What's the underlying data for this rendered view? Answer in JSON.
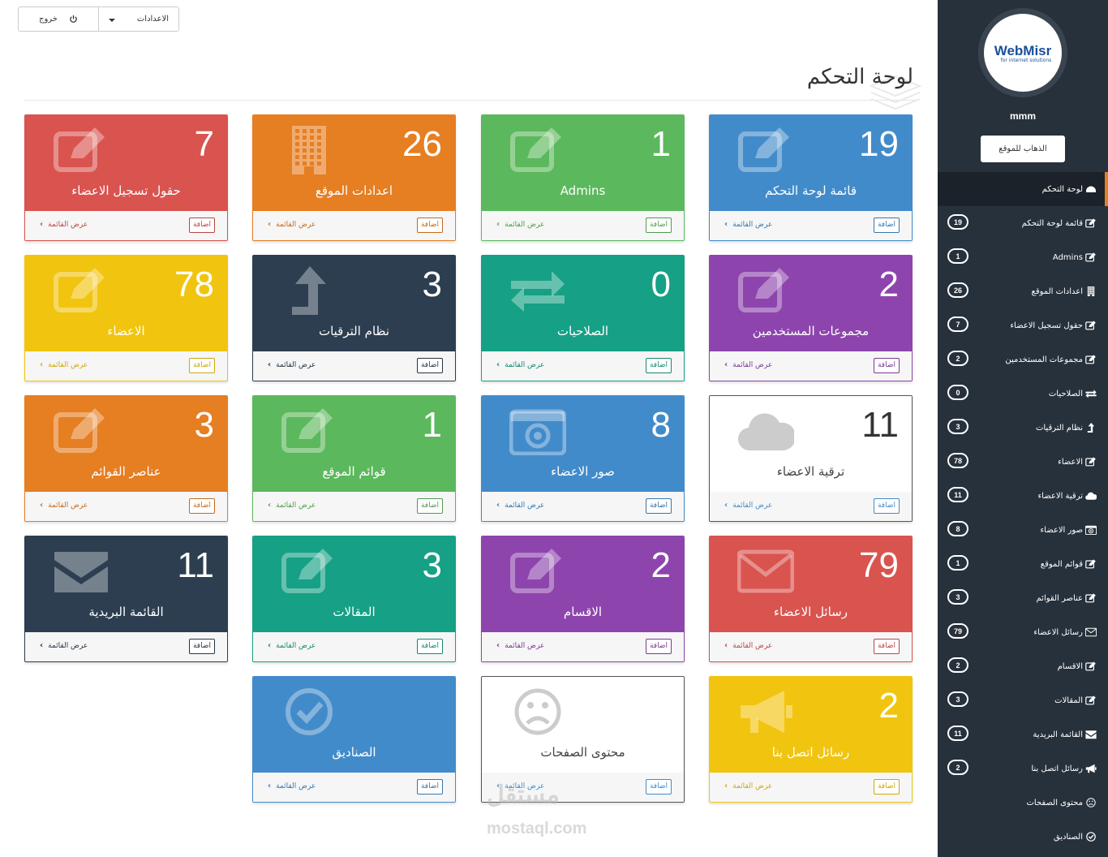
{
  "toolbar": {
    "logout_label": "خروج",
    "settings_label": "الاعدادات"
  },
  "page_title": "لوحة التحكم",
  "card_actions": {
    "add_label": "اضافة",
    "list_label": "عرض القائمة"
  },
  "colors": {
    "red": "#d9534f",
    "orange": "#e67e22",
    "green": "#5cb85c",
    "blue": "#428bca",
    "yellow": "#f1c40f",
    "navy": "#2c3e50",
    "teal": "#16a085",
    "purple": "#8e44ad",
    "white": "#ffffff"
  },
  "cards": [
    {
      "count": "19",
      "label": "قائمة لوحة التحكم",
      "color": "#428bca",
      "icon": "edit-icon"
    },
    {
      "count": "1",
      "label": "Admins",
      "color": "#5cb85c",
      "icon": "edit-icon"
    },
    {
      "count": "26",
      "label": "اعدادات الموقع",
      "color": "#e67e22",
      "icon": "building-icon"
    },
    {
      "count": "7",
      "label": "حقول تسجيل الاعضاء",
      "color": "#d9534f",
      "icon": "edit-icon"
    },
    {
      "count": "2",
      "label": "مجموعات المستخدمين",
      "color": "#8e44ad",
      "icon": "edit-icon"
    },
    {
      "count": "0",
      "label": "الصلاحيات",
      "color": "#16a085",
      "icon": "exchange-icon"
    },
    {
      "count": "3",
      "label": "نظام الترقيات",
      "color": "#2c3e50",
      "icon": "level-up-icon"
    },
    {
      "count": "78",
      "label": "الاعضاء",
      "color": "#f1c40f",
      "icon": "edit-icon"
    },
    {
      "count": "11",
      "label": "ترقية الاعضاء",
      "color": "#ffffff",
      "icon": "cloud-icon"
    },
    {
      "count": "8",
      "label": "صور الاعضاء",
      "color": "#428bca",
      "icon": "camera-icon"
    },
    {
      "count": "1",
      "label": "قوائم الموقع",
      "color": "#5cb85c",
      "icon": "edit-icon"
    },
    {
      "count": "3",
      "label": "عناصر القوائم",
      "color": "#e67e22",
      "icon": "edit-icon"
    },
    {
      "count": "79",
      "label": "رسائل الاعضاء",
      "color": "#d9534f",
      "icon": "envelope-icon"
    },
    {
      "count": "2",
      "label": "الاقسام",
      "color": "#8e44ad",
      "icon": "edit-icon"
    },
    {
      "count": "3",
      "label": "المقالات",
      "color": "#16a085",
      "icon": "edit-icon"
    },
    {
      "count": "11",
      "label": "القائمة البريدية",
      "color": "#2c3e50",
      "icon": "envelope-filled-icon"
    },
    {
      "count": "2",
      "label": "رسائل اتصل بنا",
      "color": "#f1c40f",
      "icon": "bullhorn-icon"
    },
    {
      "count": "",
      "label": "محتوى الصفحات",
      "color": "#ffffff",
      "icon": "frown-icon"
    },
    {
      "count": "",
      "label": "الصناديق",
      "color": "#428bca",
      "icon": "check-circle-icon"
    }
  ],
  "sidebar": {
    "logo_text": "WebMisr",
    "logo_sub": "for internet solutions",
    "username": "mmm",
    "goto_site_label": "الذهاب للموقع",
    "items": [
      {
        "label": "لوحة التحكم",
        "badge": "",
        "icon": "dashboard-icon"
      },
      {
        "label": "قائمة لوحة التحكم",
        "badge": "19",
        "icon": "edit-icon"
      },
      {
        "label": "Admins",
        "badge": "1",
        "icon": "edit-icon"
      },
      {
        "label": "اعدادات الموقع",
        "badge": "26",
        "icon": "building-icon"
      },
      {
        "label": "حقول تسجيل الاعضاء",
        "badge": "7",
        "icon": "edit-icon"
      },
      {
        "label": "مجموعات المستخدمين",
        "badge": "2",
        "icon": "edit-icon"
      },
      {
        "label": "الصلاحيات",
        "badge": "0",
        "icon": "exchange-icon"
      },
      {
        "label": "نظام الترقيات",
        "badge": "3",
        "icon": "level-up-icon"
      },
      {
        "label": "الاعضاء",
        "badge": "78",
        "icon": "edit-icon"
      },
      {
        "label": "ترقية الاعضاء",
        "badge": "11",
        "icon": "cloud-icon"
      },
      {
        "label": "صور الاعضاء",
        "badge": "8",
        "icon": "camera-icon"
      },
      {
        "label": "قوائم الموقع",
        "badge": "1",
        "icon": "edit-icon"
      },
      {
        "label": "عناصر القوائم",
        "badge": "3",
        "icon": "edit-icon"
      },
      {
        "label": "رسائل الاعضاء",
        "badge": "79",
        "icon": "envelope-icon"
      },
      {
        "label": "الاقسام",
        "badge": "2",
        "icon": "edit-icon"
      },
      {
        "label": "المقالات",
        "badge": "3",
        "icon": "edit-icon"
      },
      {
        "label": "القائمة البريدية",
        "badge": "11",
        "icon": "envelope-filled-icon"
      },
      {
        "label": "رسائل اتصل بنا",
        "badge": "2",
        "icon": "bullhorn-icon"
      },
      {
        "label": "محتوى الصفحات",
        "badge": "",
        "icon": "frown-icon"
      },
      {
        "label": "الصناديق",
        "badge": "",
        "icon": "check-circle-icon"
      }
    ]
  },
  "watermark": {
    "text": "مستقل",
    "sub": "mostaql.com"
  }
}
